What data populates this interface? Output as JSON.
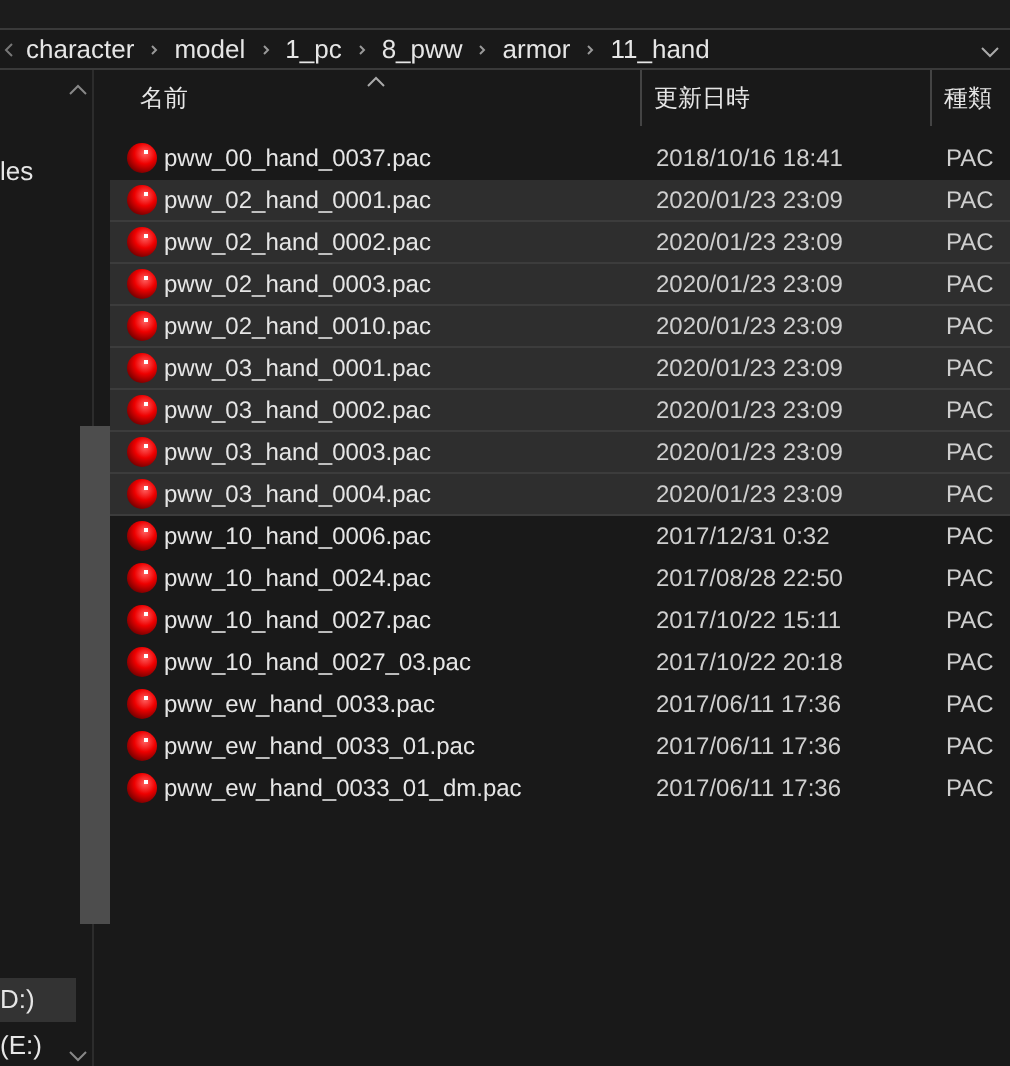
{
  "breadcrumbs": [
    "character",
    "model",
    "1_pc",
    "8_pww",
    "armor",
    "11_hand"
  ],
  "nav": {
    "items": [
      {
        "label": "les",
        "selected": false
      },
      {
        "label": "D:)",
        "selected": true
      },
      {
        "label": "(E:)",
        "selected": false
      }
    ]
  },
  "columns": [
    {
      "label": "名前",
      "sorted": true
    },
    {
      "label": "更新日時",
      "sorted": false
    },
    {
      "label": "種類",
      "sorted": false
    }
  ],
  "rows": [
    {
      "name": "pww_00_hand_0037.pac",
      "date": "2018/10/16 18:41",
      "type": "PAC",
      "selected": false
    },
    {
      "name": "pww_02_hand_0001.pac",
      "date": "2020/01/23 23:09",
      "type": "PAC",
      "selected": true
    },
    {
      "name": "pww_02_hand_0002.pac",
      "date": "2020/01/23 23:09",
      "type": "PAC",
      "selected": true
    },
    {
      "name": "pww_02_hand_0003.pac",
      "date": "2020/01/23 23:09",
      "type": "PAC",
      "selected": true
    },
    {
      "name": "pww_02_hand_0010.pac",
      "date": "2020/01/23 23:09",
      "type": "PAC",
      "selected": true
    },
    {
      "name": "pww_03_hand_0001.pac",
      "date": "2020/01/23 23:09",
      "type": "PAC",
      "selected": true
    },
    {
      "name": "pww_03_hand_0002.pac",
      "date": "2020/01/23 23:09",
      "type": "PAC",
      "selected": true
    },
    {
      "name": "pww_03_hand_0003.pac",
      "date": "2020/01/23 23:09",
      "type": "PAC",
      "selected": true
    },
    {
      "name": "pww_03_hand_0004.pac",
      "date": "2020/01/23 23:09",
      "type": "PAC",
      "selected": true
    },
    {
      "name": "pww_10_hand_0006.pac",
      "date": "2017/12/31 0:32",
      "type": "PAC",
      "selected": false
    },
    {
      "name": "pww_10_hand_0024.pac",
      "date": "2017/08/28 22:50",
      "type": "PAC",
      "selected": false
    },
    {
      "name": "pww_10_hand_0027.pac",
      "date": "2017/10/22 15:11",
      "type": "PAC",
      "selected": false
    },
    {
      "name": "pww_10_hand_0027_03.pac",
      "date": "2017/10/22 20:18",
      "type": "PAC",
      "selected": false
    },
    {
      "name": "pww_ew_hand_0033.pac",
      "date": "2017/06/11 17:36",
      "type": "PAC",
      "selected": false
    },
    {
      "name": "pww_ew_hand_0033_01.pac",
      "date": "2017/06/11 17:36",
      "type": "PAC",
      "selected": false
    },
    {
      "name": "pww_ew_hand_0033_01_dm.pac",
      "date": "2017/06/11 17:36",
      "type": "PAC",
      "selected": false
    }
  ]
}
